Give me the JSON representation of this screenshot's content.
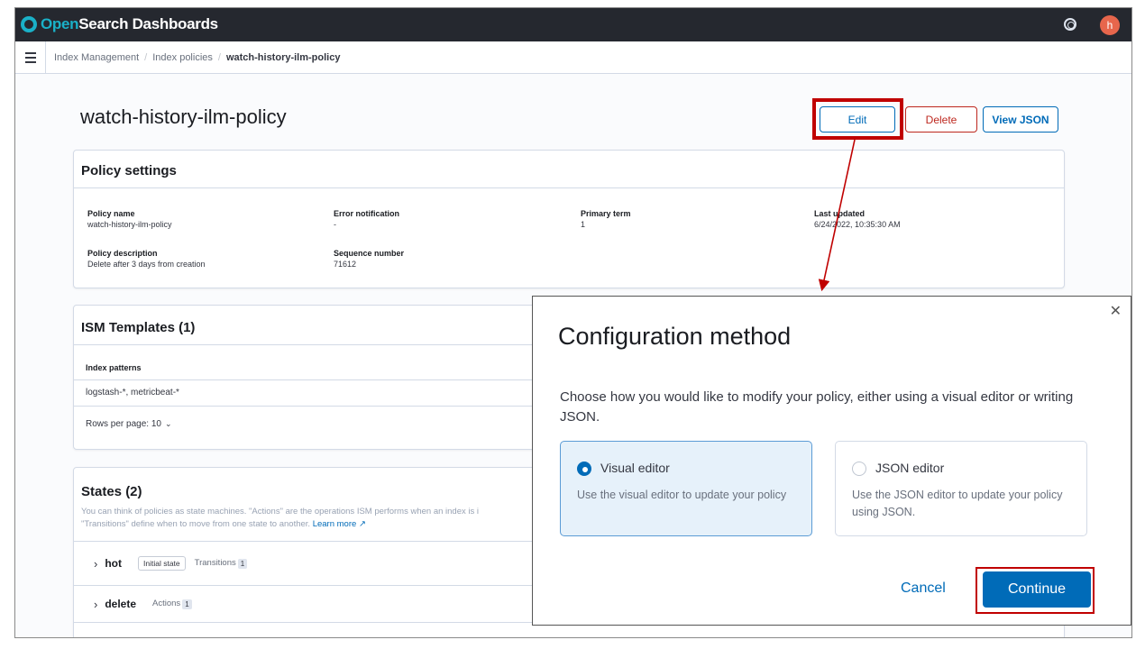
{
  "header": {
    "brand_open": "Open",
    "brand_rest": "Search Dashboards",
    "avatar_initial": "h",
    "help_icon": "help-icon"
  },
  "breadcrumb": {
    "items": [
      "Index Management",
      "Index policies",
      "watch-history-ilm-policy"
    ]
  },
  "page": {
    "title": "watch-history-ilm-policy",
    "buttons": {
      "edit": "Edit",
      "delete": "Delete",
      "view_json": "View JSON"
    }
  },
  "policy_settings": {
    "title": "Policy settings",
    "policy_name_label": "Policy name",
    "policy_name": "watch-history-ilm-policy",
    "policy_description_label": "Policy description",
    "policy_description": "Delete after 3 days from creation",
    "error_notification_label": "Error notification",
    "error_notification": "-",
    "sequence_number_label": "Sequence number",
    "sequence_number": "71612",
    "primary_term_label": "Primary term",
    "primary_term": "1",
    "last_updated_label": "Last updated",
    "last_updated": "6/24/2022, 10:35:30 AM"
  },
  "ism_templates": {
    "title": "ISM Templates (1)",
    "column_header": "Index patterns",
    "rows": [
      "logstash-*, metricbeat-*"
    ],
    "rows_per_page": "Rows per page: 10"
  },
  "states": {
    "title": "States (2)",
    "description_line1": "You can think of policies as state machines. \"Actions\" are the operations ISM performs when an index is i",
    "description_line2": "\"Transitions\" define when to move from one state to another.",
    "learn_more": "Learn more",
    "items": [
      {
        "name": "hot",
        "tag": "Initial state",
        "meta_label": "Transitions",
        "meta_count": "1"
      },
      {
        "name": "delete",
        "tag": "",
        "meta_label": "Actions",
        "meta_count": "1"
      }
    ]
  },
  "modal": {
    "title": "Configuration method",
    "description": "Choose how you would like to modify your policy, either using a visual editor or writing JSON.",
    "options": [
      {
        "label": "Visual editor",
        "description": "Use the visual editor to update your policy",
        "selected": true
      },
      {
        "label": "JSON editor",
        "description": "Use the JSON editor to update your policy using JSON.",
        "selected": false
      }
    ],
    "cancel": "Cancel",
    "continue": "Continue"
  },
  "colors": {
    "annotation_red": "#c00000",
    "primary_blue": "#006bb8",
    "danger_red": "#bd271e",
    "header_dark": "#25282f",
    "brand_teal": "#1ab1c8"
  }
}
